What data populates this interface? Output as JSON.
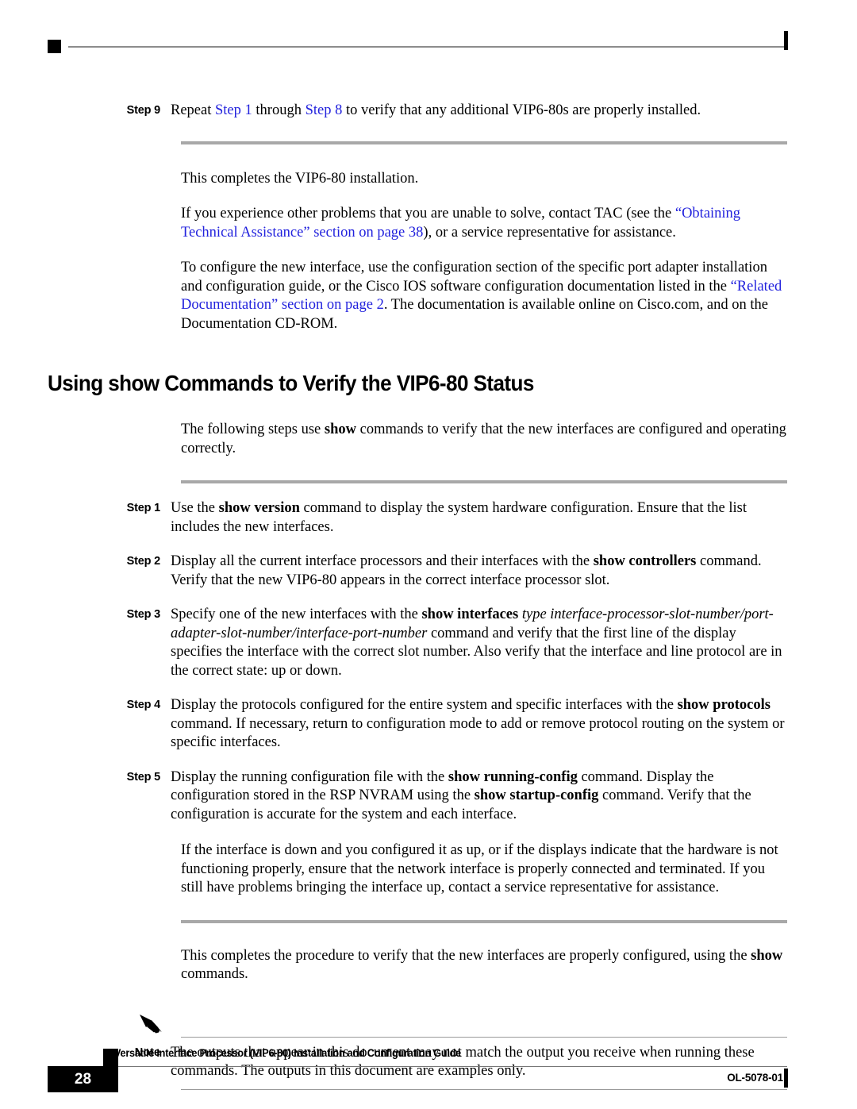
{
  "page": {
    "number": "28",
    "doc_id": "OL-5078-01",
    "footer_title": "Versatile Interface Processor (VIP6-80) Installation and Configuration Guide"
  },
  "link_color": "#2222dd",
  "top_step": {
    "label": "Step 9",
    "text_a": "Repeat ",
    "link_1": "Step 1",
    "text_b": " through ",
    "link_2": "Step 8",
    "text_c": " to verify that any additional VIP6-80s are properly installed."
  },
  "intro_paragraphs": {
    "p1": "This completes the VIP6-80 installation.",
    "p2_a": "If you experience other problems that you are unable to solve, contact TAC (see the ",
    "p2_link": "“Obtaining Technical Assistance” section on page 38",
    "p2_b": "), or a service representative for assistance.",
    "p3_a": "To configure the new interface, use the configuration section of the specific port adapter installation and configuration guide, or the Cisco IOS software configuration documentation listed in the ",
    "p3_link": "“Related Documentation” section on page 2",
    "p3_b": ". The documentation is available online on Cisco.com, and on the Documentation CD-ROM."
  },
  "heading": "Using show Commands to Verify the VIP6-80 Status",
  "lead_paragraph": {
    "a": "The following steps use ",
    "bold": "show",
    "b": " commands to verify that the new interfaces are configured and operating correctly."
  },
  "steps": [
    {
      "label": "Step 1",
      "parts": [
        {
          "t": "Use the ",
          "s": "normal"
        },
        {
          "t": "show version",
          "s": "bold"
        },
        {
          "t": " command to display the system hardware configuration. Ensure that the list includes the new interfaces.",
          "s": "normal"
        }
      ]
    },
    {
      "label": "Step 2",
      "parts": [
        {
          "t": "Display all the current interface processors and their interfaces with the ",
          "s": "normal"
        },
        {
          "t": "show controllers",
          "s": "bold"
        },
        {
          "t": " command. Verify that the new VIP6-80 appears in the correct interface processor slot.",
          "s": "normal"
        }
      ]
    },
    {
      "label": "Step 3",
      "parts": [
        {
          "t": "Specify one of the new interfaces with the ",
          "s": "normal"
        },
        {
          "t": "show interfaces",
          "s": "bold"
        },
        {
          "t": " ",
          "s": "normal"
        },
        {
          "t": "type interface-processor-slot-number/port-adapter-slot-number/interface-port-number",
          "s": "italic"
        },
        {
          "t": " command and verify that the first line of the display specifies the interface with the correct slot number. Also verify that the interface and line protocol are in the correct state: up or down.",
          "s": "normal"
        }
      ]
    },
    {
      "label": "Step 4",
      "parts": [
        {
          "t": "Display the protocols configured for the entire system and specific interfaces with the ",
          "s": "normal"
        },
        {
          "t": "show protocols",
          "s": "bold"
        },
        {
          "t": " command. If necessary, return to configuration mode to add or remove protocol routing on the system or specific interfaces.",
          "s": "normal"
        }
      ]
    },
    {
      "label": "Step 5",
      "parts": [
        {
          "t": "Display the running configuration file with the ",
          "s": "normal"
        },
        {
          "t": "show running-config",
          "s": "bold"
        },
        {
          "t": " command. Display the configuration stored in the RSP NVRAM using the ",
          "s": "normal"
        },
        {
          "t": "show startup-config",
          "s": "bold"
        },
        {
          "t": " command. Verify that the configuration is accurate for the system and each interface.",
          "s": "normal"
        }
      ]
    }
  ],
  "trailing_paragraph": "If the interface is down and you configured it as up, or if the displays indicate that the hardware is not functioning properly, ensure that the network interface is properly connected and terminated. If you still have problems bringing the interface up, contact a service representative for assistance.",
  "closing_paragraph": {
    "a": "This completes the procedure to verify that the new interfaces are properly configured, using the ",
    "bold": "show",
    "b": " commands."
  },
  "note": {
    "label": "Note",
    "icon": "pencil-icon",
    "text": "The outputs that appear in this document may not match the output you receive when running these commands. The outputs in this document are examples only."
  }
}
